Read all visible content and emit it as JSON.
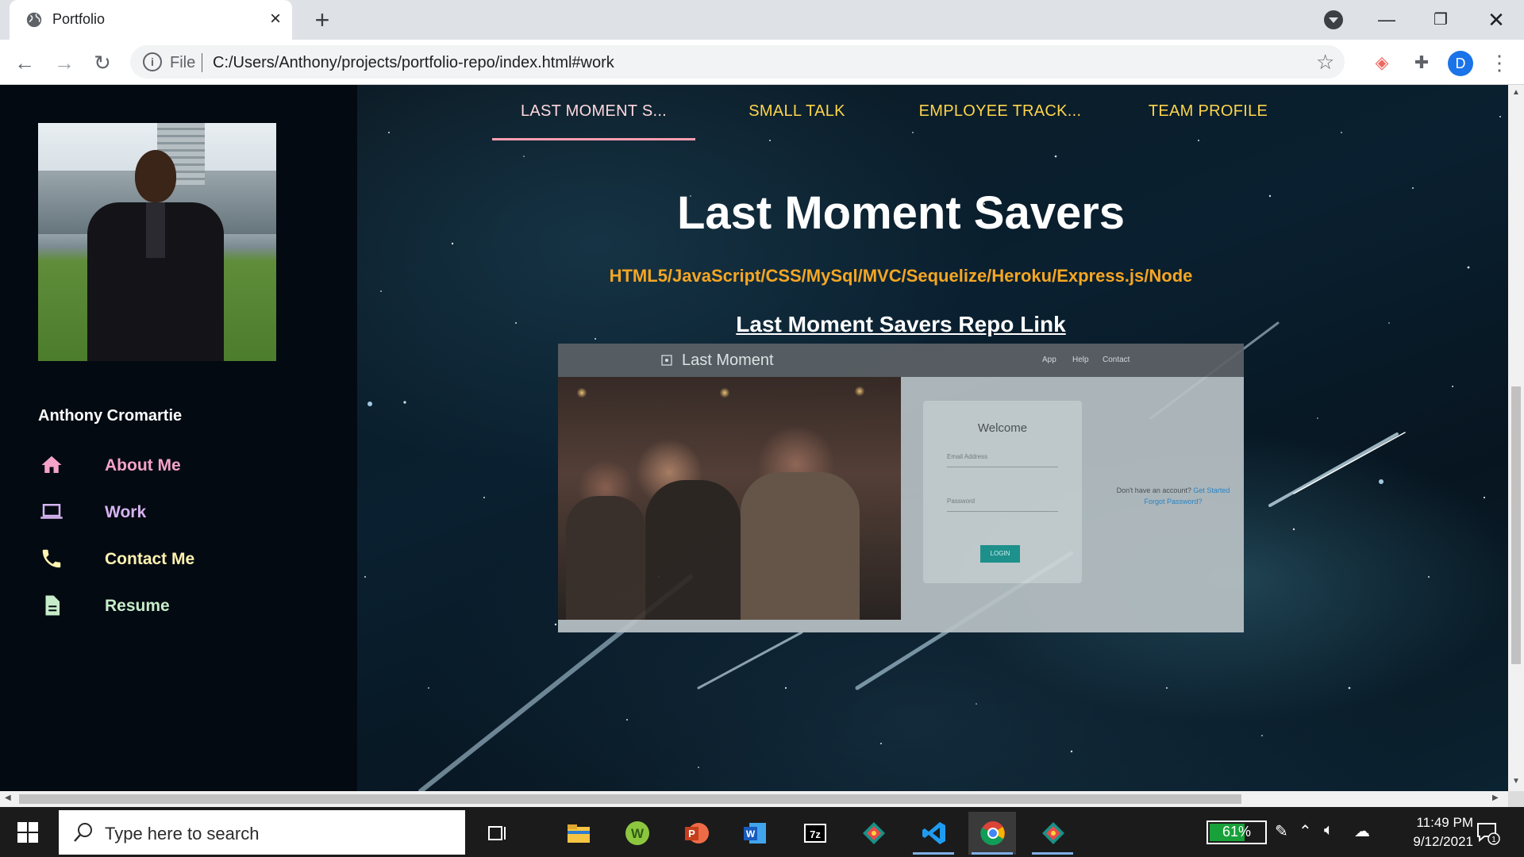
{
  "browser": {
    "tab_title": "Portfolio",
    "url_scheme": "File",
    "url": "C:/Users/Anthony/projects/portfolio-repo/index.html#work",
    "profile_initial": "D"
  },
  "sidebar": {
    "name": "Anthony Cromartie",
    "items": [
      {
        "label": "About Me",
        "icon": "home-icon",
        "color": "#f4a3c9"
      },
      {
        "label": "Work",
        "icon": "laptop-icon",
        "color": "#d6b4f0"
      },
      {
        "label": "Contact Me",
        "icon": "phone-icon",
        "color": "#fff3b0"
      },
      {
        "label": "Resume",
        "icon": "document-icon",
        "color": "#c6ecc9"
      }
    ]
  },
  "project_tabs": [
    {
      "label": "LAST MOMENT S...",
      "active": true
    },
    {
      "label": "SMALL TALK",
      "active": false
    },
    {
      "label": "EMPLOYEE TRACK...",
      "active": false
    },
    {
      "label": "TEAM PROFILE",
      "active": false
    }
  ],
  "project": {
    "title": "Last Moment Savers",
    "stack": "HTML5/JavaScript/CSS/MySql/MVC/Sequelize/Heroku/Express.js/Node",
    "repo_link": "Last Moment Savers Repo Link",
    "screenshot": {
      "brand": "Last Moment",
      "nav": [
        "App",
        "Help",
        "Contact"
      ],
      "welcome": "Welcome",
      "email_placeholder": "Email Address",
      "password_placeholder": "Password",
      "login_label": "LOGIN",
      "signup_prompt": "Don't have an account?",
      "signup_link": "Get Started",
      "forgot_link": "Forgot Password?"
    }
  },
  "taskbar": {
    "search_placeholder": "Type here to search",
    "battery": "61%",
    "battery_level": 0.61,
    "time": "11:49 PM",
    "date": "9/12/2021",
    "notification_count": "1",
    "apps": [
      "task-view-icon",
      "file-explorer-icon",
      "wps-icon",
      "powerpoint-icon",
      "word-icon",
      "7zip-icon",
      "gitkraken-icon",
      "vscode-icon",
      "chrome-icon",
      "gitkraken-icon"
    ]
  },
  "colors": {
    "tab_gold": "#ffd54a",
    "tab_active_underline": "#ff9fb0",
    "stack_orange": "#f5a623",
    "sidebar_bg": "#030a12"
  }
}
